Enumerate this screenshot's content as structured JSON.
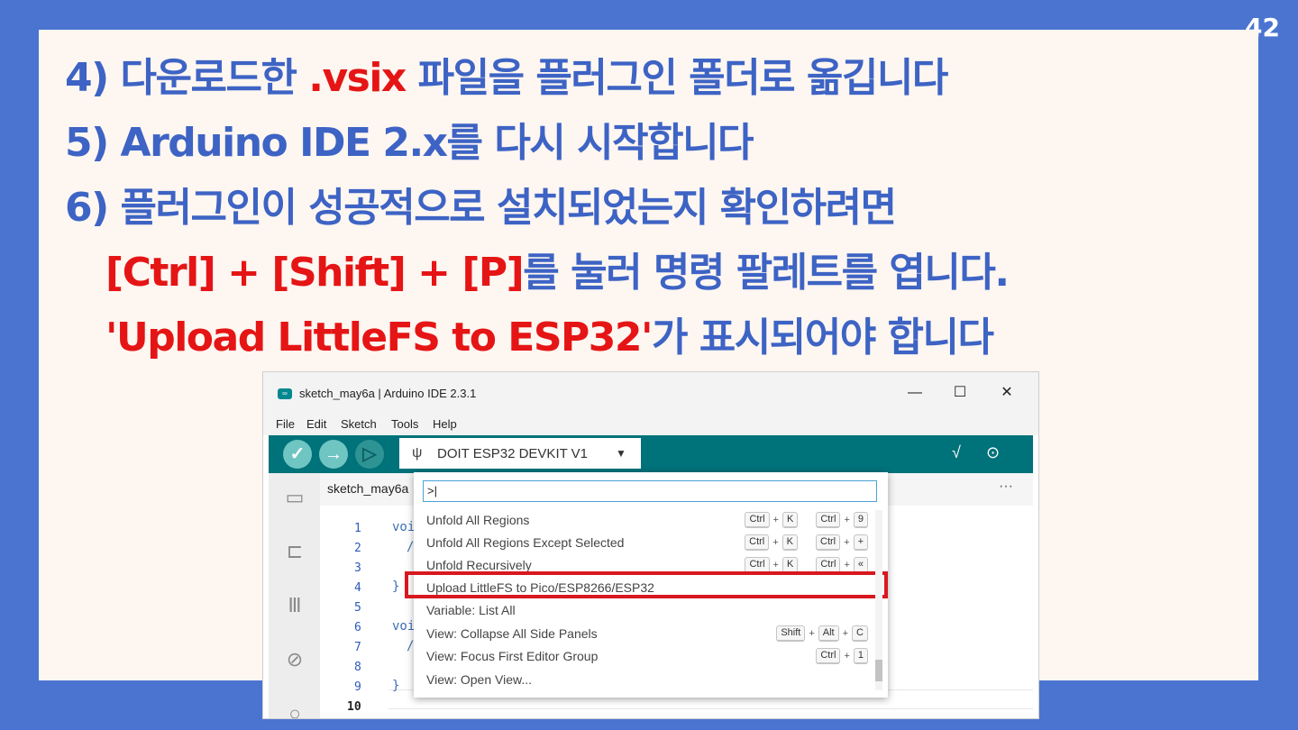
{
  "page_number": "42",
  "instructions": {
    "line1": {
      "prefix": "4) 다운로드한 ",
      "highlight": ".vsix",
      "suffix": " 파일을 플러그인 폴더로 옮깁니다"
    },
    "line2": {
      "text": "5) Arduino IDE 2.x를 다시 시작합니다"
    },
    "line3": {
      "text": "6) 플러그인이 성공적으로 설치되었는지 확인하려면"
    },
    "line4": {
      "highlight": "[Ctrl] + [Shift] + [P]",
      "suffix": "를 눌러 명령 팔레트를 엽니다."
    },
    "line5": {
      "quote_open": "'",
      "highlight": "Upload LittleFS to ESP32",
      "quote_close": "'",
      "suffix": "가 표시되어야 합니다"
    }
  },
  "ide": {
    "window_title": "sketch_may6a | Arduino IDE 2.3.1",
    "window_controls": {
      "minimize": "—",
      "maximize": "☐",
      "close": "✕"
    },
    "menu": [
      "File",
      "Edit",
      "Sketch",
      "Tools",
      "Help"
    ],
    "toolbar": {
      "verify_icon": "✓",
      "upload_icon": "→",
      "debug_icon": "▷",
      "board_usb_icon": "ψ",
      "board": "DOIT ESP32 DEVKIT V1",
      "board_caret": "▼",
      "plotter_icon": "√",
      "monitor_icon": "⊙"
    },
    "sidebar_icons": [
      "folder-icon",
      "board-icon",
      "library-icon",
      "debug-icon",
      "search-icon"
    ],
    "tab": "sketch_may6a",
    "tab_more": "···",
    "line_numbers": [
      "1",
      "2",
      "3",
      "4",
      "5",
      "6",
      "7",
      "8",
      "9",
      "10"
    ],
    "code_fragments": [
      "voi",
      "/",
      "}",
      "voi",
      "/",
      "}"
    ]
  },
  "palette": {
    "input": ">|",
    "commands": [
      {
        "label": "Unfold All Regions",
        "keys1": [
          "Ctrl",
          "K"
        ],
        "keys2": [
          "Ctrl",
          "9"
        ]
      },
      {
        "label": "Unfold All Regions Except Selected",
        "keys1": [
          "Ctrl",
          "K"
        ],
        "keys2": [
          "Ctrl",
          "+"
        ]
      },
      {
        "label": "Unfold Recursively",
        "keys1": [
          "Ctrl",
          "K"
        ],
        "keys2": [
          "Ctrl",
          "«"
        ]
      },
      {
        "label": "Upload LittleFS to Pico/ESP8266/ESP32",
        "highlighted": true
      },
      {
        "label": "Variable: List All"
      },
      {
        "label": "View: Collapse All Side Panels",
        "keys1": [
          "Shift",
          "Alt",
          "C"
        ]
      },
      {
        "label": "View: Focus First Editor Group",
        "keys1": [
          "Ctrl",
          "1"
        ]
      },
      {
        "label": "View: Open View..."
      }
    ]
  },
  "colors": {
    "background": "#4a74d0",
    "heading_blue": "#3d63c4",
    "accent_red": "#e51515",
    "toolbar_teal": "#00727a",
    "highlight_red": "#d8181f"
  }
}
